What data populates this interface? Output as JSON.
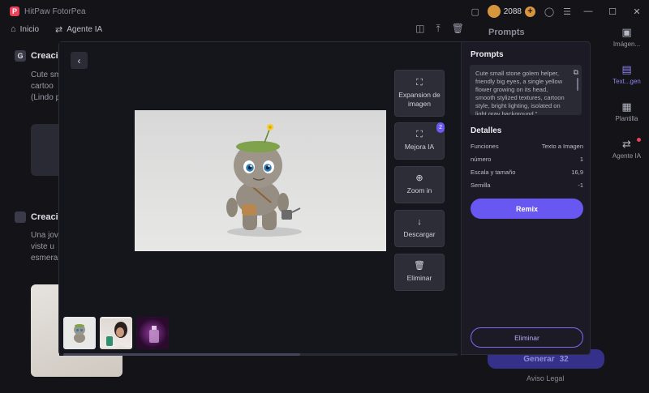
{
  "app": {
    "name": "HitPaw FotorPea",
    "logo_letter": "P"
  },
  "titlebar": {
    "coins": "2088"
  },
  "nav": {
    "home": "Inicio",
    "agent": "Agente IA"
  },
  "feed": {
    "cards": [
      {
        "badge": "G",
        "title": "Creació",
        "text_lines": [
          "Cute sm",
          "cartoo",
          "(Lindo p"
        ]
      },
      {
        "badge": "",
        "title": "Creació",
        "text_lines": [
          "Una jov",
          "viste u",
          "esmera"
        ]
      }
    ]
  },
  "right_panel": {
    "title": "Prompts",
    "generate": "Generar",
    "generate_cost": "32",
    "legal": "Aviso Legal"
  },
  "sidebar": {
    "items": [
      {
        "label": "Imágen..."
      },
      {
        "label": "Text...gen"
      },
      {
        "label": "Plantilla"
      },
      {
        "label": "Agente IA"
      }
    ]
  },
  "modal": {
    "tools": [
      {
        "label": "Expansion de imagen"
      },
      {
        "label": "Mejora IA",
        "badge": "2"
      },
      {
        "label": "Zoom in"
      },
      {
        "label": "Descargar"
      },
      {
        "label": "Eliminar"
      }
    ],
    "panel": {
      "prompts_heading": "Prompts",
      "prompt_text": "Cute small stone golem helper, friendly big eyes, a single yellow flower growing on its head, smooth stylized textures, cartoon style, bright lighting, isolated on light gray background.\"",
      "details_heading": "Detalles",
      "details": [
        {
          "label": "Funciones",
          "value": "Texto a Imagen"
        },
        {
          "label": "número",
          "value": "1"
        },
        {
          "label": "Escala y tamaño",
          "value": "16,9"
        },
        {
          "label": "Semilla",
          "value": "-1"
        }
      ],
      "remix": "Remix",
      "delete": "Eliminar"
    }
  }
}
